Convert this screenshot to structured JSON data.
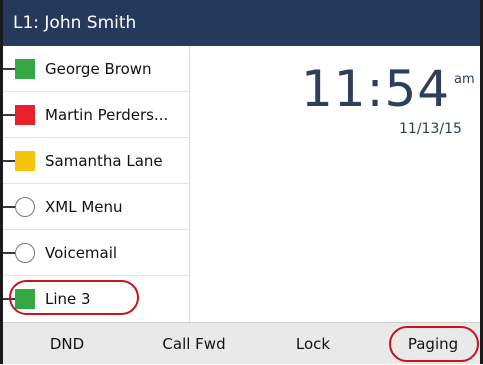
{
  "header": {
    "title": "L1: John Smith"
  },
  "line_keys": [
    {
      "label": "George Brown",
      "indicator": "square",
      "color": "#35a844"
    },
    {
      "label": "Martin Perders...",
      "indicator": "square",
      "color": "#e8202a"
    },
    {
      "label": "Samantha Lane",
      "indicator": "square",
      "color": "#f6c40a"
    },
    {
      "label": "XML Menu",
      "indicator": "circle",
      "color": "#ffffff"
    },
    {
      "label": "Voicemail",
      "indicator": "circle",
      "color": "#ffffff"
    },
    {
      "label": "Line 3",
      "indicator": "square",
      "color": "#35a844"
    }
  ],
  "clock": {
    "time": "11:54",
    "ampm": "am",
    "date": "11/13/15"
  },
  "softkeys": [
    {
      "label": "DND"
    },
    {
      "label": "Call Fwd"
    },
    {
      "label": "Lock"
    },
    {
      "label": "Paging"
    }
  ],
  "colors": {
    "header_bg": "#253a5a",
    "clock_text": "#2d3f5c",
    "softkey_bg": "#e9e9e9",
    "callout": "#c8141c"
  }
}
